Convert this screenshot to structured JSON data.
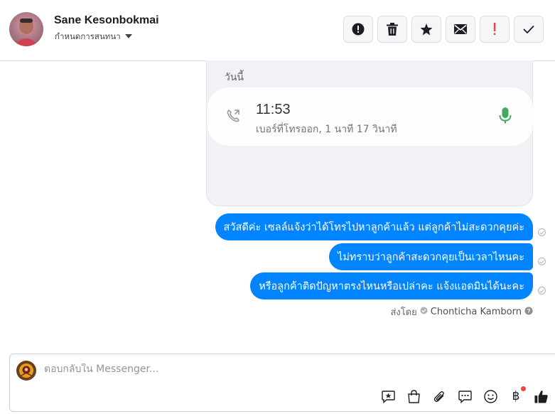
{
  "header": {
    "contact_name": "Sane Kesonbokmai",
    "assign_label": "กำหนดการสนทนา",
    "actions": [
      {
        "name": "report-spam-button",
        "icon": "exclamation-circle-icon"
      },
      {
        "name": "delete-button",
        "icon": "trash-icon"
      },
      {
        "name": "star-button",
        "icon": "star-icon"
      },
      {
        "name": "mark-unread-button",
        "icon": "envelope-icon"
      },
      {
        "name": "mark-important-button",
        "icon": "exclamation-icon"
      },
      {
        "name": "mark-done-button",
        "icon": "checkmark-icon"
      }
    ]
  },
  "call_card": {
    "date_label": "วันนี้",
    "time": "11:53",
    "description": "เบอร์ที่โทรออก, 1 นาที 17 วินาที",
    "call_icon": "outgoing-call-icon",
    "mic_icon": "microphone-icon"
  },
  "messages": [
    {
      "text": "สวัสดีค่ะ เซลล์แจ้งว่าได้โทรไปหาลูกค้าแล้ว แต่ลูกค้าไม่สะดวกคุยค่ะ"
    },
    {
      "text": "ไม่ทราบว่าลูกค้าสะดวกคุยเป็นเวลาไหนคะ"
    },
    {
      "text": "หรือลูกค้าติดปัญหาตรงไหนหรือเปล่าคะ แจ้งแอดมินได้นะคะ"
    }
  ],
  "sent_by": {
    "label": "ส่งโดย",
    "agent": "Chonticha Kamborn"
  },
  "composer": {
    "placeholder": "ตอบกลับใน Messenger...",
    "tools": [
      "saved-replies-icon",
      "shop-bag-icon",
      "attachment-icon",
      "chat-bubbles-icon",
      "emoji-icon",
      "payment-icon",
      "like-icon"
    ]
  },
  "colors": {
    "bubble": "#0084ff",
    "call_card_bg": "#f0f2f5",
    "mic_green": "#31a24c",
    "important_red": "#fa3e3e"
  }
}
